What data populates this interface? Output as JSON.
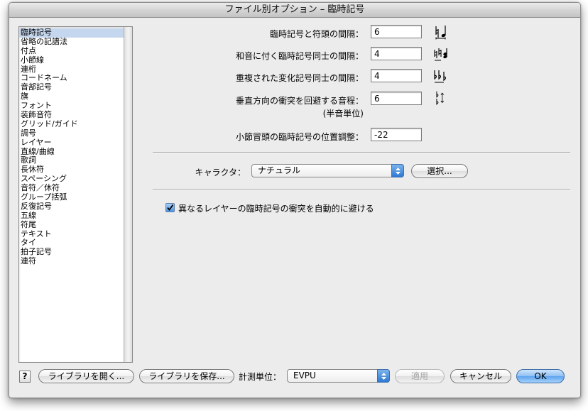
{
  "window": {
    "title": "ファイル別オプション – 臨時記号"
  },
  "sidebar": {
    "items": [
      "臨時記号",
      "省略の記譜法",
      "付点",
      "小節線",
      "連桁",
      "コードネーム",
      "音部記号",
      "旗",
      "フォント",
      "装飾音符",
      "グリッド/ガイド",
      "調号",
      "レイヤー",
      "直線/曲線",
      "歌詞",
      "長休符",
      "スペーシング",
      "音符／休符",
      "グループ括弧",
      "反復記号",
      "五線",
      "符尾",
      "テキスト",
      "タイ",
      "拍子記号",
      "連符"
    ],
    "selected": "臨時記号"
  },
  "settings": {
    "acc_to_note_label": "臨時記号と符頭の間隔：",
    "acc_to_note_value": "6",
    "chord_acc_label": "和音に付く臨時記号同士の間隔：",
    "chord_acc_value": "4",
    "multi_acc_label": "重複された変化記号同士の間隔：",
    "multi_acc_value": "4",
    "vertical_label": "垂直方向の衝突を回避する音程：",
    "vertical_sub_label": "(半音単位)",
    "vertical_value": "6",
    "measure_start_label": "小節冒頭の臨時記号の位置調整：",
    "measure_start_value": "-22"
  },
  "character": {
    "label": "キャラクタ：",
    "selected": "ナチュラル",
    "select_button": "選択..."
  },
  "auto_avoid": {
    "label": "異なるレイヤーの臨時記号の衝突を自動的に避ける",
    "checked": true
  },
  "footer": {
    "help": "?",
    "open_library": "ライブラリを開く...",
    "save_library": "ライブラリを保存...",
    "units_label": "計測単位：",
    "units_value": "EVPU",
    "apply": "適用",
    "cancel": "キャンセル",
    "ok": "OK"
  },
  "icons": {
    "acc_to_note": "natural-note-spacing-icon",
    "chord_acc": "chord-accidentals-icon",
    "multi_acc": "multiple-flats-icon",
    "vertical": "vertical-collision-icon",
    "checkbox": "check-icon",
    "popup_arrows": "up-down-arrows-icon"
  },
  "colors": {
    "accent": "#5ea3ee",
    "selection": "#c5d7ef",
    "window_bg": "#ececec"
  }
}
